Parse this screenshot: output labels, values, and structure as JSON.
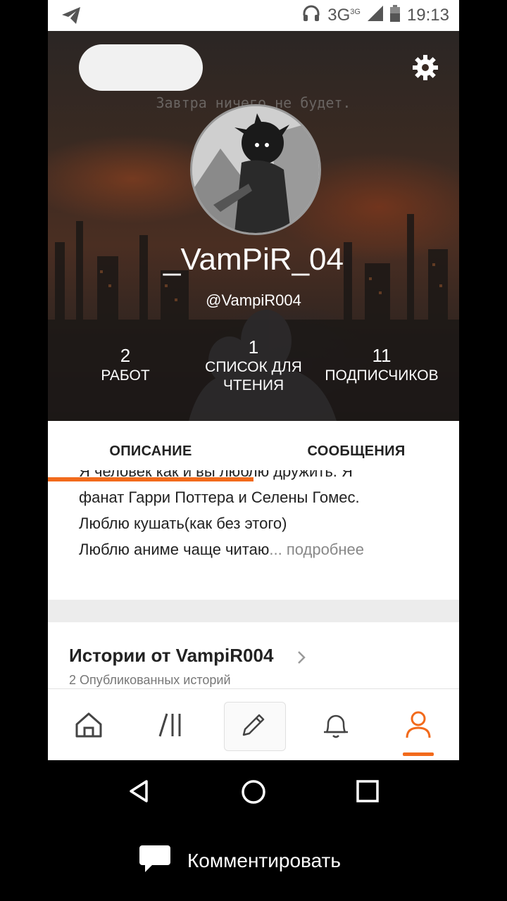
{
  "status_bar": {
    "network": "3G",
    "network_sup": "3G",
    "time": "19:13"
  },
  "profile": {
    "tagline": "Завтра ничего не будет.",
    "display_name": "_VamPiR_04",
    "handle": "@VampiR004",
    "stats": [
      {
        "value": "2",
        "label": "РАБОТ"
      },
      {
        "value": "1",
        "label": "СПИСОК ДЛЯ ЧТЕНИЯ"
      },
      {
        "value": "11",
        "label": "ПОДПИСЧИКОВ"
      }
    ]
  },
  "tabs": {
    "about": "ОПИСАНИЕ",
    "messages": "СООБЩЕНИЯ",
    "active": "about"
  },
  "description": {
    "line_cut": "Я человек как и вы люблю дружить. Я",
    "line1": "фанат Гарри Поттера и Селены Гомес.",
    "line2": "Люблю кушать(как без этого)",
    "line3": "Люблю аниме чаще читаю",
    "ellipsis": "...",
    "more": "подробнее"
  },
  "stories": {
    "title": "Истории от VampiR004",
    "subtitle": "2 Опубликованных историй"
  },
  "bottom_nav": {
    "items": [
      "home-icon",
      "library-icon",
      "write-icon",
      "notifications-icon",
      "profile-icon"
    ],
    "active": "profile-icon"
  },
  "comment_bar": {
    "label": "Комментировать"
  },
  "colors": {
    "accent": "#f26a1b",
    "background": "#000000"
  }
}
